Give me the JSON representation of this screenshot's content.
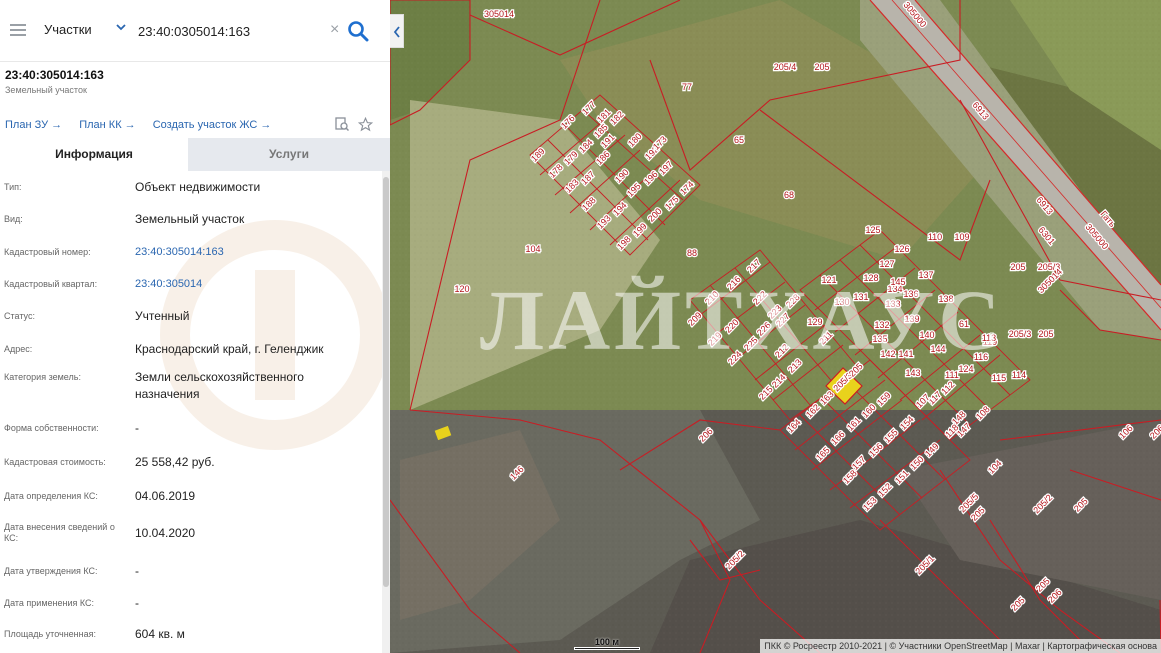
{
  "search": {
    "type_label": "Участки",
    "query_value": "23:40:0305014:163",
    "clear_symbol": "×"
  },
  "object": {
    "title": "23:40:305014:163",
    "subtitle": "Земельный участок"
  },
  "links": [
    {
      "label": "План ЗУ"
    },
    {
      "label": "План КК"
    },
    {
      "label": "Создать участок ЖС"
    }
  ],
  "tabs": {
    "info": "Информация",
    "services": "Услуги"
  },
  "attributes": [
    {
      "label": "Тип:",
      "value": "Объект недвижимости",
      "link": false
    },
    {
      "label": "Вид:",
      "value": "Земельный участок",
      "link": false
    },
    {
      "label": "Кадастровый номер:",
      "value": "23:40:305014:163",
      "link": true
    },
    {
      "label": "Кадастровый квартал:",
      "value": "23:40:305014",
      "link": true
    },
    {
      "label": "Статус:",
      "value": "Учтенный",
      "link": false
    },
    {
      "label": "Адрес:",
      "value": "Краснодарский край, г. Геленджик",
      "link": false
    },
    {
      "label": "Категория земель:",
      "value": "Земли сельскохозяйственного назначения",
      "link": false
    },
    {
      "label": "Форма собственности:",
      "value": "-",
      "link": false
    },
    {
      "label": "Кадастровая стоимость:",
      "value": "25 558,42 руб.",
      "link": false
    },
    {
      "label": "Дата определения КС:",
      "value": "04.06.2019",
      "link": false
    },
    {
      "label": "Дата внесения сведений о КС:",
      "value": "10.04.2020",
      "link": false
    },
    {
      "label": "Дата утверждения КС:",
      "value": "-",
      "link": false
    },
    {
      "label": "Дата применения КС:",
      "value": "-",
      "link": false
    },
    {
      "label": "Площадь уточненная:",
      "value": "604 кв. м",
      "link": false
    }
  ],
  "map": {
    "watermark": "ЛАЙТХАУС",
    "scale_label": "100 м",
    "attribution": "ПКК © Росреестр 2010-2021 | © Участники OpenStreetMap | Maxar | Картографическая основа",
    "road_labels": [
      "6913",
      "305014",
      "305000",
      "6913",
      "6301",
      "Гать",
      "305000"
    ],
    "plot_labels": [
      "177",
      "176",
      "181",
      "182",
      "189",
      "179",
      "184",
      "185",
      "186",
      "178",
      "183",
      "188",
      "193",
      "190",
      "195",
      "194",
      "196",
      "192",
      "197",
      "187",
      "175",
      "200",
      "199",
      "198",
      "191",
      "180",
      "174",
      "173",
      "77",
      "205/4",
      "205",
      "65",
      "68",
      "88",
      "104",
      "120",
      "217",
      "216",
      "210",
      "209",
      "219",
      "220",
      "222",
      "223",
      "228",
      "227",
      "226",
      "224",
      "225",
      "212",
      "213",
      "214",
      "215",
      "211",
      "121",
      "125",
      "129",
      "130",
      "127",
      "126",
      "128",
      "131",
      "132",
      "133",
      "134",
      "135",
      "136",
      "137",
      "138",
      "139",
      "140",
      "141",
      "142",
      "143",
      "144",
      "145",
      "61",
      "124",
      "119",
      "116",
      "115",
      "114",
      "113",
      "111",
      "110",
      "109",
      "205/3",
      "205",
      "205/3",
      "205",
      "305014",
      "205/3",
      "205",
      "163",
      "162",
      "164",
      "165",
      "166",
      "161",
      "160",
      "159",
      "158",
      "157",
      "156",
      "155",
      "154",
      "153",
      "152",
      "151",
      "150",
      "149",
      "148",
      "147",
      "118",
      "117",
      "112",
      "107",
      "108",
      "106",
      "206",
      "205/5",
      "205",
      "205/2",
      "205",
      "205/1",
      "205",
      "206",
      "205",
      "205/2",
      "206",
      "146",
      "104",
      "120",
      "205"
    ]
  }
}
